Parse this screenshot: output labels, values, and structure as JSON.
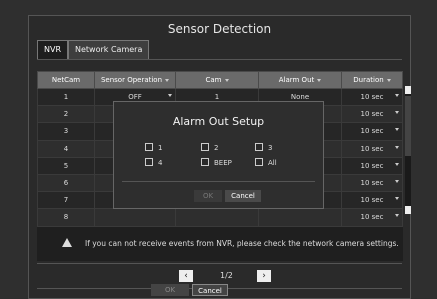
{
  "dialog": {
    "title": "Sensor Detection",
    "tabs": [
      "NVR",
      "Network Camera"
    ],
    "columns": [
      "NetCam",
      "Sensor Operation",
      "Cam",
      "Alarm Out",
      "Duration"
    ],
    "rows": [
      {
        "netcam": "1",
        "sensor": "OFF",
        "cam": "1",
        "alarm": "None",
        "duration": "10 sec"
      },
      {
        "netcam": "2",
        "sensor": "",
        "cam": "",
        "alarm": "",
        "duration": "10 sec"
      },
      {
        "netcam": "3",
        "sensor": "",
        "cam": "",
        "alarm": "",
        "duration": "10 sec"
      },
      {
        "netcam": "4",
        "sensor": "",
        "cam": "",
        "alarm": "",
        "duration": "10 sec"
      },
      {
        "netcam": "5",
        "sensor": "",
        "cam": "",
        "alarm": "",
        "duration": "10 sec"
      },
      {
        "netcam": "6",
        "sensor": "",
        "cam": "",
        "alarm": "",
        "duration": "10 sec"
      },
      {
        "netcam": "7",
        "sensor": "",
        "cam": "",
        "alarm": "",
        "duration": "10 sec"
      },
      {
        "netcam": "8",
        "sensor": "",
        "cam": "",
        "alarm": "",
        "duration": "10 sec"
      }
    ],
    "notice": "If you can not receive events from NVR, please check the network camera settings.",
    "page": "1/2",
    "prev_icon": "chevron-left-icon",
    "next_icon": "chevron-right-icon",
    "ok_label": "OK",
    "cancel_label": "Cancel"
  },
  "alarm_popup": {
    "title": "Alarm Out Setup",
    "options": [
      "1",
      "2",
      "3",
      "4",
      "BEEP",
      "All"
    ],
    "ok_label": "OK",
    "cancel_label": "Cancel"
  }
}
